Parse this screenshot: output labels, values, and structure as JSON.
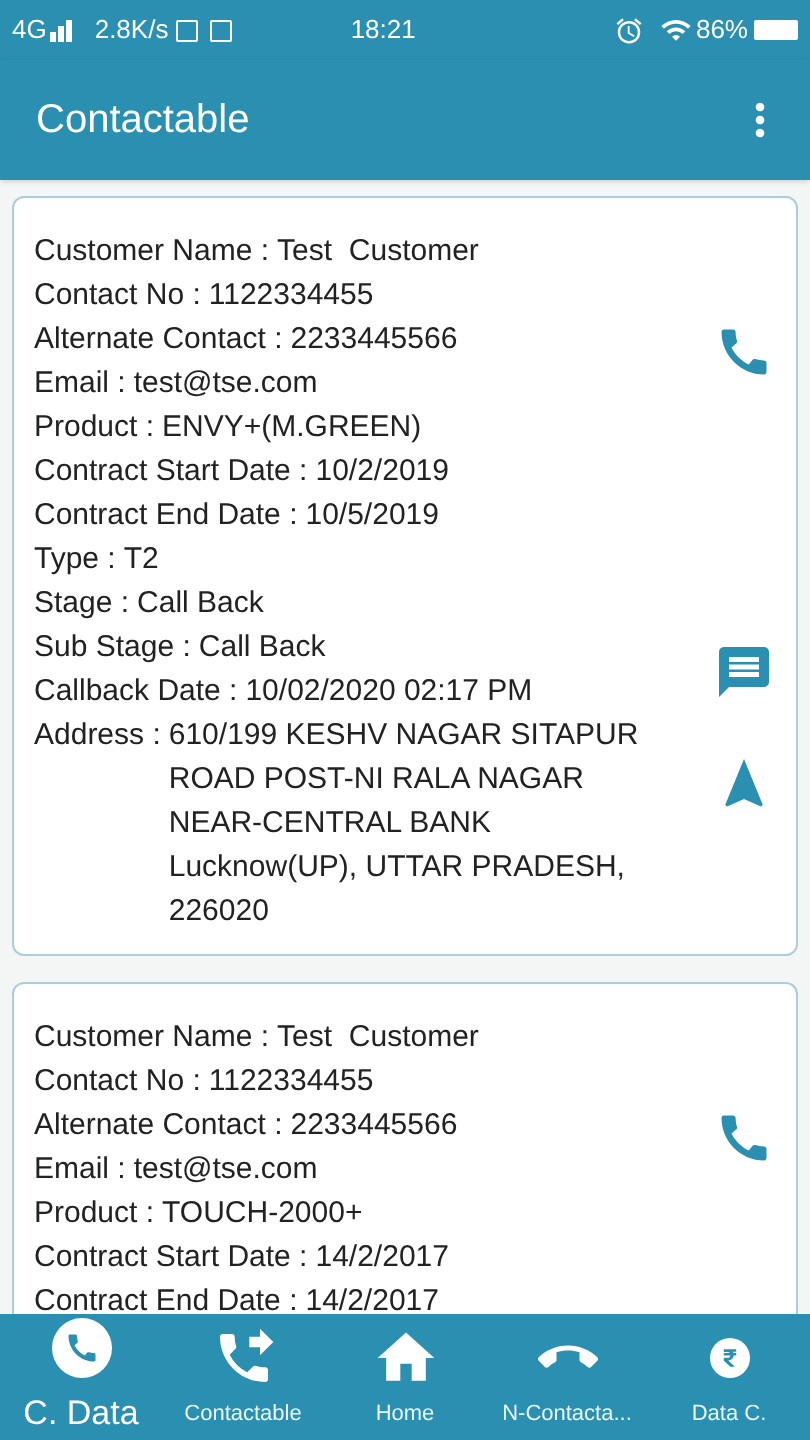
{
  "status_bar": {
    "network": "4G",
    "speed": "2.8K/s",
    "time": "18:21",
    "battery": "86%"
  },
  "app_bar": {
    "title": "Contactable"
  },
  "cards": [
    {
      "fields": [
        {
          "label": "Customer Name :",
          "value": "Test  Customer"
        },
        {
          "label": "Contact No :",
          "value": "1122334455"
        },
        {
          "label": "Alternate Contact :",
          "value": "2233445566"
        },
        {
          "label": "Email :",
          "value": "test@tse.com"
        },
        {
          "label": "Product :",
          "value": "ENVY+(M.GREEN)"
        },
        {
          "label": "Contract Start Date :",
          "value": "10/2/2019"
        },
        {
          "label": "Contract End Date :",
          "value": "10/5/2019"
        },
        {
          "label": "Type :",
          "value": "T2"
        },
        {
          "label": "Stage :",
          "value": "Call Back"
        },
        {
          "label": "Sub Stage :",
          "value": "Call Back"
        },
        {
          "label": "Callback Date :",
          "value": "10/02/2020 02:17 PM"
        },
        {
          "label": "Address :",
          "value": "610/199 KESHV NAGAR SITAPUR ROAD POST-NI RALA NAGAR NEAR-CENTRAL BANK Lucknow(UP), UTTAR PRADESH, 226020",
          "kind": "block"
        }
      ],
      "actions": [
        {
          "kind": "call"
        },
        {
          "kind": "message"
        },
        {
          "kind": "navigate"
        }
      ]
    },
    {
      "fields": [
        {
          "label": "Customer Name :",
          "value": "Test  Customer"
        },
        {
          "label": "Contact No :",
          "value": "1122334455"
        },
        {
          "label": "Alternate Contact :",
          "value": "2233445566"
        },
        {
          "label": "Email :",
          "value": "test@tse.com"
        },
        {
          "label": "Product :",
          "value": "TOUCH-2000+"
        },
        {
          "label": "Contract Start Date :",
          "value": "14/2/2017"
        },
        {
          "label": "Contract End Date :",
          "value": "14/2/2017"
        }
      ],
      "actions": [
        {
          "kind": "call"
        }
      ]
    }
  ],
  "bottom_nav": [
    {
      "label": "C. Data",
      "kind": "data",
      "selected": true
    },
    {
      "label": "Contactable",
      "kind": "contactable",
      "selected": false
    },
    {
      "label": "Home",
      "kind": "home",
      "selected": false
    },
    {
      "label": "N-Contacta...",
      "kind": "not-contactable",
      "selected": false
    },
    {
      "label": "Data C.",
      "kind": "collection",
      "selected": false
    }
  ]
}
